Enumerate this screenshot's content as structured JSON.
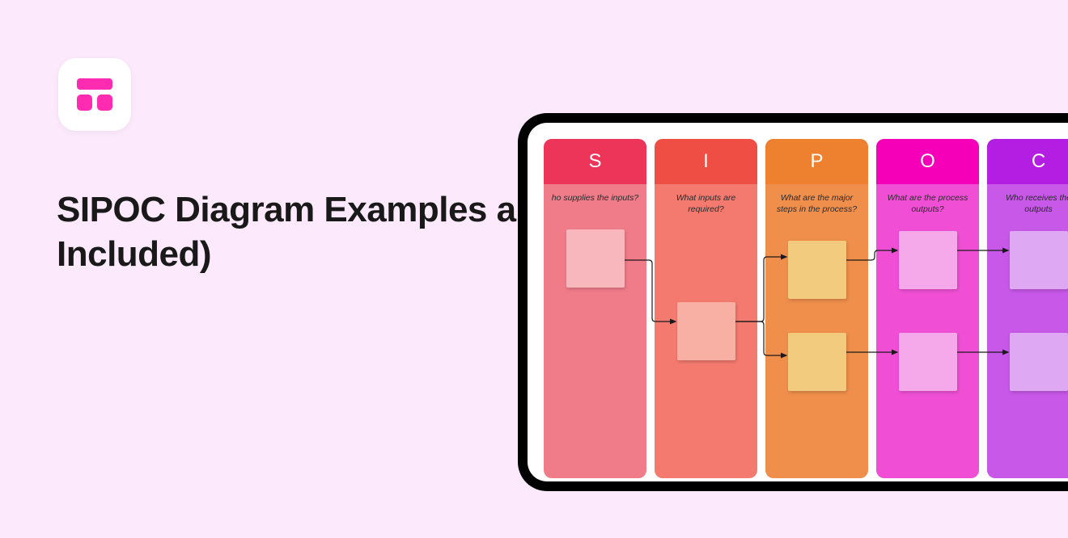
{
  "title": "SIPOC Diagram Examples and Creation Guide (Template Included)",
  "columns": {
    "s": {
      "letter": "S",
      "question": "ho supplies the inputs?"
    },
    "i": {
      "letter": "I",
      "question": "What inputs are required?"
    },
    "p": {
      "letter": "P",
      "question": "What are the major steps in the process?"
    },
    "o": {
      "letter": "O",
      "question": "What are the process outputs?"
    },
    "c": {
      "letter": "C",
      "question": "Who receives the outputs"
    }
  }
}
